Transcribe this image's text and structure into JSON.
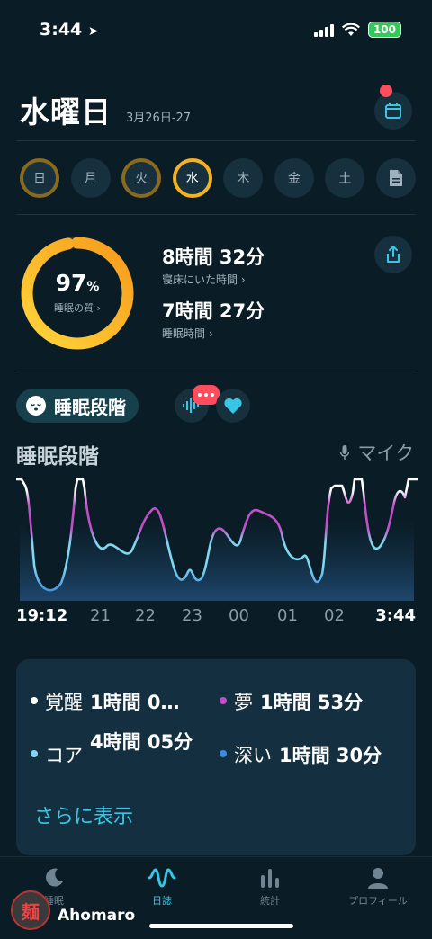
{
  "status_bar": {
    "time": "3:44",
    "battery": "100"
  },
  "header": {
    "day": "水曜日",
    "date_range": "3月26日-27",
    "calendar_icon": "calendar-icon"
  },
  "week": [
    "日",
    "月",
    "火",
    "水",
    "木",
    "金",
    "土"
  ],
  "score": {
    "value": "97",
    "unit": "%",
    "label": "睡眠の質 ›",
    "percent": 97
  },
  "in_bed": {
    "value": "8時間 32分",
    "label": "寝床にいた時間 ›"
  },
  "asleep": {
    "value": "7時間 27分",
    "label": "睡眠時間 ›"
  },
  "section_pill": "睡眠段階",
  "chart": {
    "title": "睡眠段階",
    "mic_label": "マイク",
    "time_labels": [
      "19:12",
      "21",
      "22",
      "23",
      "00",
      "01",
      "02",
      "3:44"
    ]
  },
  "chart_data": {
    "type": "line",
    "categories": [
      "19:12",
      "21",
      "22",
      "23",
      "00",
      "01",
      "02",
      "3:44"
    ],
    "levels": [
      "覚醒",
      "夢",
      "コア",
      "深い"
    ],
    "series_colors": {
      "awake": "#ffffff",
      "rem": "#c24fc8",
      "core": "#7fd8f0",
      "deep": "#3e8bde"
    }
  },
  "summary": {
    "awake": {
      "label": "覚醒",
      "value": "1時間 0…",
      "color": "#ffffff"
    },
    "rem": {
      "label": "夢",
      "value": "1時間 53分",
      "color": "#c24fc8"
    },
    "core": {
      "label": "コア",
      "value": "4時間 05分",
      "color": "#7fd8f0"
    },
    "deep": {
      "label": "深い",
      "value": "1時間 30分",
      "color": "#3e8bde"
    },
    "more": "さらに表示"
  },
  "tabs": [
    {
      "label": "睡眠",
      "icon": "moon-icon"
    },
    {
      "label": "日誌",
      "icon": "wave-icon"
    },
    {
      "label": "統計",
      "icon": "bar-chart-icon"
    },
    {
      "label": "プロフィール",
      "icon": "person-icon"
    }
  ],
  "watermark": {
    "badge": "麺",
    "name": "Ahomaro"
  }
}
